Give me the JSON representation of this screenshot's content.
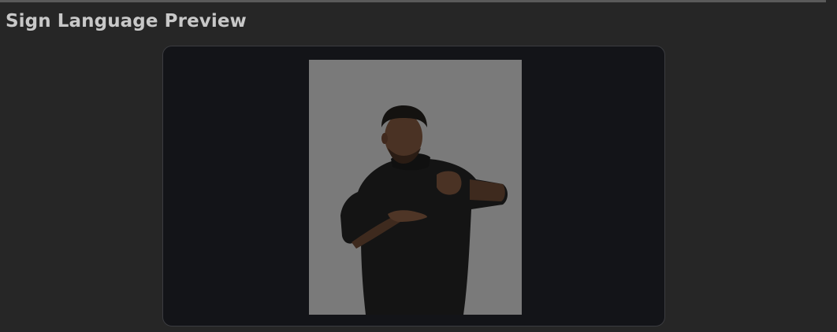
{
  "section": {
    "title": "Sign Language Preview"
  },
  "preview": {
    "video_bg": "#7a7a7a",
    "frame_bg": "#131418",
    "content": "signer-video"
  },
  "colors": {
    "page_bg": "#262626",
    "title_text": "#c8c8c8",
    "frame_border": "#3b3c40"
  }
}
